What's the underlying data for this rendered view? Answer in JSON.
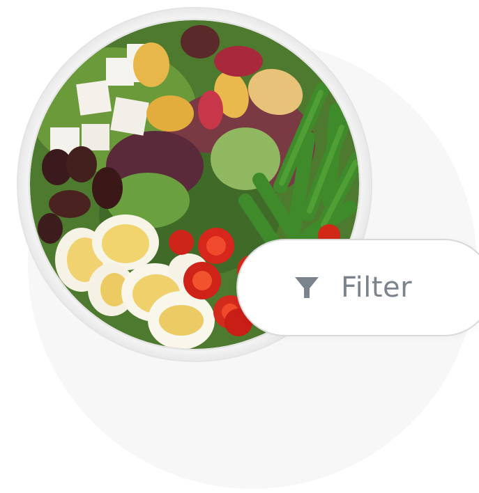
{
  "image": {
    "alt": "salad-bowl"
  },
  "filter_button": {
    "label": "Filter",
    "icon": "funnel-icon",
    "text_color": "#7b838c",
    "border_color": "#d9d9d9"
  },
  "colors": {
    "background_circle": "#f7f7f7",
    "bowl_rim": "#f2f2f2"
  }
}
